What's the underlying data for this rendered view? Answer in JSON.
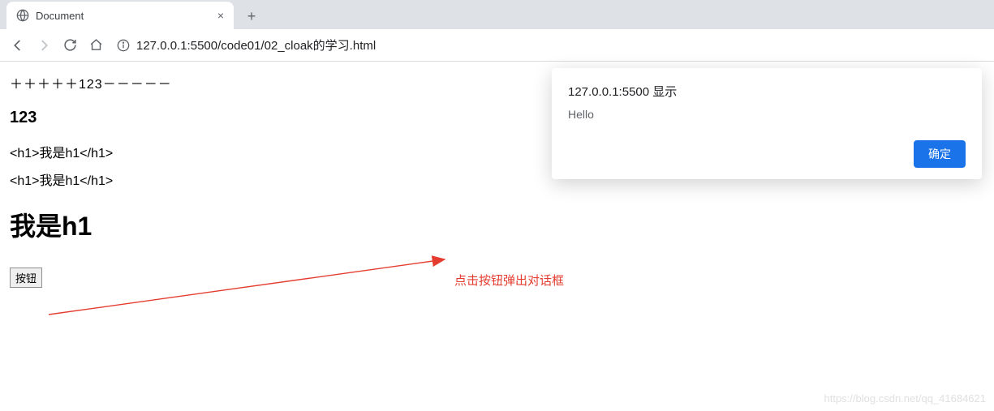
{
  "browser": {
    "tab": {
      "title": "Document"
    },
    "url": "127.0.0.1:5500/code01/02_cloak的学习.html"
  },
  "page": {
    "line1": "＋＋＋＋＋123－－－－－",
    "line2": "123",
    "raw_h1_a": "<h1>我是h1</h1>",
    "raw_h1_b": "<h1>我是h1</h1>",
    "rendered_h1": "我是h1",
    "button_label": "按钮"
  },
  "alert": {
    "title": "127.0.0.1:5500 显示",
    "message": "Hello",
    "ok_label": "确定"
  },
  "annotation": {
    "text": "点击按钮弹出对话框",
    "color": "#e43c2f"
  },
  "watermark": "https://blog.csdn.net/qq_41684621"
}
